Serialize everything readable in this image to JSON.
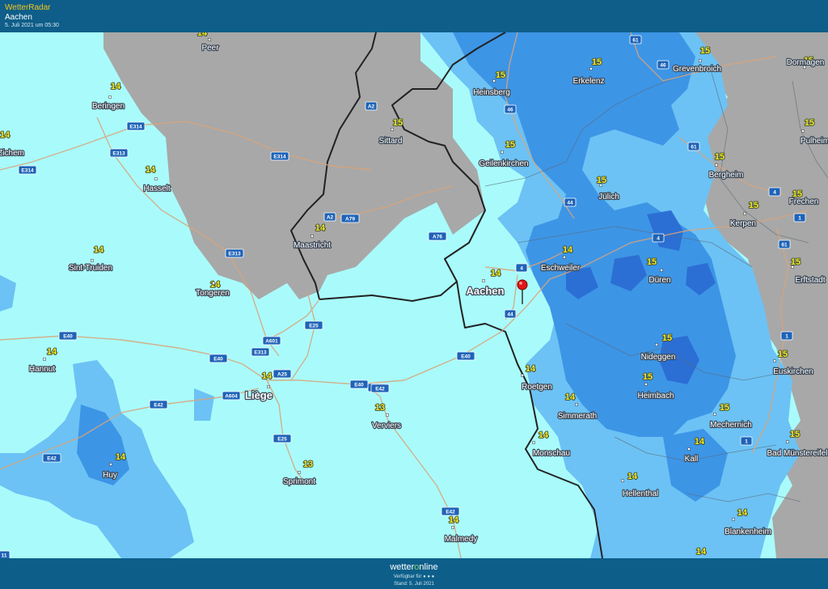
{
  "header": {
    "brand": "WetterRadar",
    "location": "Aachen",
    "timestamp": "5. Juli 2021 um 05:30"
  },
  "footer": {
    "logo_prefix": "wetter",
    "logo_o": "o",
    "logo_suffix": "nline",
    "available": "Verfügbar für",
    "stand": "Stand: 5. Juli 2021"
  },
  "colors": {
    "header_bg": "#0e5e89",
    "brand": "#f5c518",
    "precip_none": "#a9fbfb",
    "precip_light": "#6cc2f4",
    "precip_moderate": "#3d95e6",
    "precip_heavy": "#2c6fd4",
    "cloud": "#a8a8a8",
    "temperature_text": "#f2ea2c"
  },
  "marker": {
    "label": "location-pin"
  },
  "places": [
    {
      "name": "Peer",
      "temp": "14"
    },
    {
      "name": "Beringen",
      "temp": "14"
    },
    {
      "name": "uvel-Zichem",
      "temp": "14"
    },
    {
      "name": "Hasselt",
      "temp": "14"
    },
    {
      "name": "Sint-Truiden",
      "temp": "14"
    },
    {
      "name": "Tongeren",
      "temp": "14"
    },
    {
      "name": "Hannut",
      "temp": "14"
    },
    {
      "name": "Huy",
      "temp": "14"
    },
    {
      "name": "Liège",
      "temp": "14"
    },
    {
      "name": "Verviers",
      "temp": "13"
    },
    {
      "name": "Sprimont",
      "temp": "13"
    },
    {
      "name": "Malmedy",
      "temp": "14"
    },
    {
      "name": "Maastricht",
      "temp": "14"
    },
    {
      "name": "Sittard",
      "temp": "15"
    },
    {
      "name": "Heinsberg",
      "temp": "15"
    },
    {
      "name": "Geilenkirchen",
      "temp": "15"
    },
    {
      "name": "Erkelenz",
      "temp": "15"
    },
    {
      "name": "Grevenbroich",
      "temp": "15"
    },
    {
      "name": "Dormagen",
      "temp": "15"
    },
    {
      "name": "Jülich",
      "temp": "15"
    },
    {
      "name": "Bergheim",
      "temp": "15"
    },
    {
      "name": "Pulheim",
      "temp": "15"
    },
    {
      "name": "Kerpen",
      "temp": "15"
    },
    {
      "name": "Frechen",
      "temp": "15"
    },
    {
      "name": "Erftstadt",
      "temp": "15"
    },
    {
      "name": "Aachen",
      "temp": "14"
    },
    {
      "name": "Eschweiler",
      "temp": "14"
    },
    {
      "name": "Düren",
      "temp": "15"
    },
    {
      "name": "Nideggen",
      "temp": "15"
    },
    {
      "name": "Roetgen",
      "temp": "14"
    },
    {
      "name": "Simmerath",
      "temp": "14"
    },
    {
      "name": "Heimbach",
      "temp": "15"
    },
    {
      "name": "Monschau",
      "temp": "14"
    },
    {
      "name": "Euskirchen",
      "temp": "15"
    },
    {
      "name": "Mechernich",
      "temp": "15"
    },
    {
      "name": "Bad Münstereifel",
      "temp": "15"
    },
    {
      "name": "Kall",
      "temp": "14"
    },
    {
      "name": "Hellenthal",
      "temp": "14"
    },
    {
      "name": "Blankenheim",
      "temp": "14"
    },
    {
      "name": "",
      "temp": "14"
    }
  ],
  "roads": [
    "E314",
    "E313",
    "E314",
    "E314",
    "A2",
    "A2",
    "A79",
    "E313",
    "A76",
    "E40",
    "E40",
    "A601",
    "E313",
    "E25",
    "A25",
    "A604",
    "E42",
    "E42",
    "E40",
    "E42",
    "E25",
    "E42",
    "E40",
    "E42",
    "46",
    "46",
    "61",
    "61",
    "61",
    "4",
    "4",
    "44",
    "44",
    "4",
    "1",
    "1",
    "1",
    "1",
    "11"
  ]
}
